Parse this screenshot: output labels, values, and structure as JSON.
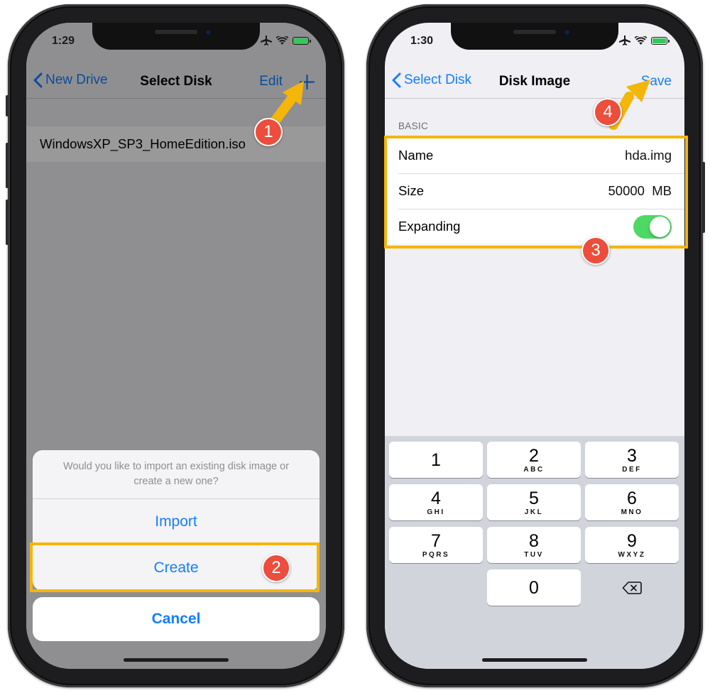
{
  "colors": {
    "ios_blue": "#147efb",
    "switch_on": "#4cd964",
    "highlight": "#f5b60a",
    "badge": "#ec4d3c"
  },
  "left_screen": {
    "status_time": "1:29",
    "status_icons": [
      "airplane-icon",
      "wifi-icon",
      "battery-charging-icon"
    ],
    "nav": {
      "back_label": "New Drive",
      "title": "Select Disk",
      "edit_label": "Edit",
      "add_icon": "plus-icon"
    },
    "files": [
      {
        "name": "WindowsXP_SP3_HomeEdition.iso"
      }
    ],
    "action_sheet": {
      "message": "Would you like to import an existing disk image or create a new one?",
      "import_label": "Import",
      "create_label": "Create",
      "cancel_label": "Cancel"
    }
  },
  "right_screen": {
    "status_time": "1:30",
    "status_icons": [
      "airplane-icon",
      "wifi-icon",
      "battery-charging-icon"
    ],
    "nav": {
      "back_label": "Select Disk",
      "title": "Disk Image",
      "save_label": "Save"
    },
    "section_header": "BASIC",
    "form": {
      "name_label": "Name",
      "name_value": "hda.img",
      "size_label": "Size",
      "size_value": "50000  MB",
      "expanding_label": "Expanding",
      "expanding_on": true
    },
    "keypad": [
      {
        "digit": "1",
        "letters": ""
      },
      {
        "digit": "2",
        "letters": "ABC"
      },
      {
        "digit": "3",
        "letters": "DEF"
      },
      {
        "digit": "4",
        "letters": "GHI"
      },
      {
        "digit": "5",
        "letters": "JKL"
      },
      {
        "digit": "6",
        "letters": "MNO"
      },
      {
        "digit": "7",
        "letters": "PQRS"
      },
      {
        "digit": "8",
        "letters": "TUV"
      },
      {
        "digit": "9",
        "letters": "WXYZ"
      },
      {
        "digit": "0",
        "letters": ""
      }
    ],
    "delete_icon": "backspace-icon"
  },
  "annotations": {
    "step_1": "1",
    "step_2": "2",
    "step_3": "3",
    "step_4": "4"
  }
}
